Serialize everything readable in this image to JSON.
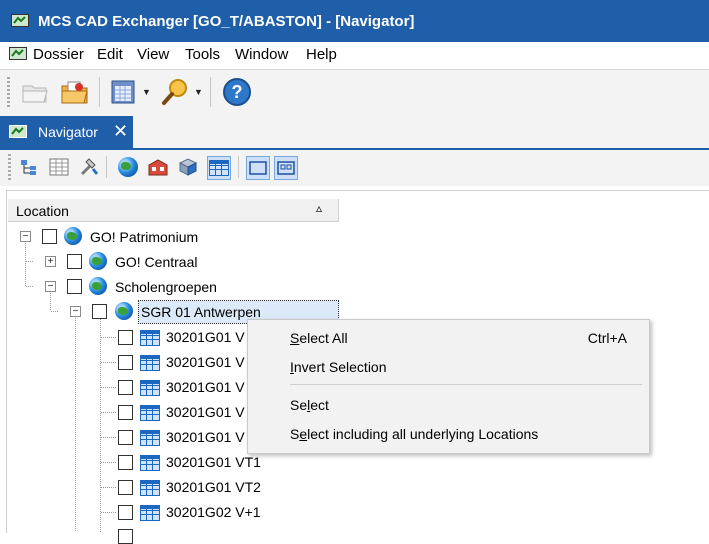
{
  "window": {
    "title": "MCS CAD Exchanger [GO_T/ABASTON] - [Navigator]"
  },
  "menu": [
    "Dossier",
    "Edit",
    "View",
    "Tools",
    "Window",
    "Help"
  ],
  "toolbar": {
    "icons": [
      "open-folder-icon",
      "dossier-icon",
      "layout-icon",
      "search-icon",
      "help-icon"
    ]
  },
  "tab": {
    "label": "Navigator",
    "close": "✕"
  },
  "nav_toolbar": {
    "icons": [
      "tree-view-icon",
      "table-view-icon",
      "tools-icon",
      "globe-icon",
      "building-icon",
      "floor-icon",
      "grid-icon",
      "rectangle-icon",
      "group-icon"
    ]
  },
  "tree": {
    "column_header": "Location",
    "sort_indicator": "▵",
    "nodes": [
      {
        "label": "GO! Patrimonium",
        "expander": "−",
        "icon": "globe-icon"
      },
      {
        "label": "GO! Centraal",
        "expander": "+",
        "icon": "globe-icon"
      },
      {
        "label": "Scholengroepen",
        "expander": "−",
        "icon": "globe-icon"
      },
      {
        "label": "SGR 01 Antwerpen",
        "expander": "−",
        "icon": "globe-icon",
        "selected": true
      },
      {
        "label": "30201G01 V",
        "icon": "grid-icon"
      },
      {
        "label": "30201G01 V",
        "icon": "grid-icon"
      },
      {
        "label": "30201G01 V",
        "icon": "grid-icon"
      },
      {
        "label": "30201G01 V",
        "icon": "grid-icon"
      },
      {
        "label": "30201G01 V",
        "icon": "grid-icon"
      },
      {
        "label": "30201G01 VT1",
        "icon": "grid-icon"
      },
      {
        "label": "30201G01 VT2",
        "icon": "grid-icon"
      },
      {
        "label": "30201G02 V+1",
        "icon": "grid-icon"
      }
    ]
  },
  "context_menu": {
    "items": [
      {
        "pre": "",
        "accel": "S",
        "post": "elect All",
        "shortcut": "Ctrl+A"
      },
      {
        "pre": "",
        "accel": "I",
        "post": "nvert Selection",
        "shortcut": ""
      },
      {
        "pre": "Se",
        "accel": "l",
        "post": "ect",
        "shortcut": ""
      },
      {
        "pre": "S",
        "accel": "e",
        "post": "lect including all underlying Locations",
        "shortcut": ""
      }
    ]
  },
  "colors": {
    "title_bar": "#1f5ea8",
    "selection": "#dce9f8",
    "menu_bg": "#f2f2f2"
  }
}
